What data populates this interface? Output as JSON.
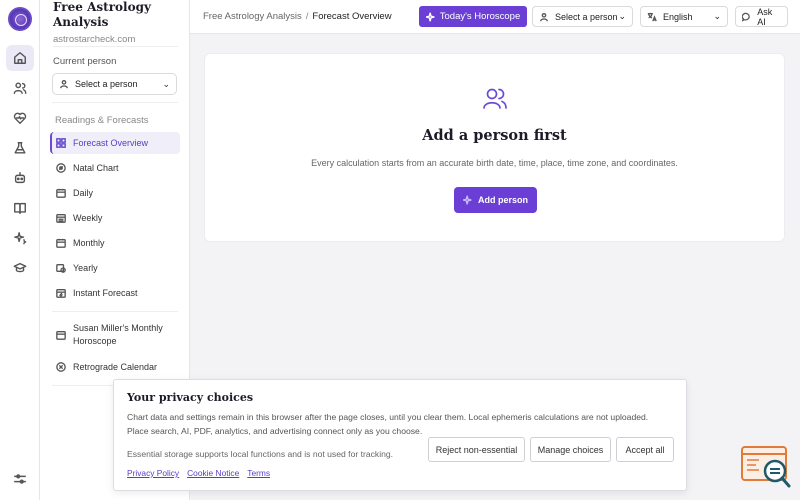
{
  "app": {
    "title": "Free Astrology Analysis",
    "domain": "astrostarcheck.com"
  },
  "sidebar": {
    "current_person_label": "Current person",
    "person_select": "Select a person",
    "section_label": "Readings & Forecasts",
    "items": [
      {
        "label": "Forecast Overview",
        "icon": "grid-icon"
      },
      {
        "label": "Natal Chart",
        "icon": "chart-wheel-icon"
      },
      {
        "label": "Daily",
        "icon": "calendar-icon"
      },
      {
        "label": "Weekly",
        "icon": "calendar-week-icon"
      },
      {
        "label": "Monthly",
        "icon": "calendar-month-icon"
      },
      {
        "label": "Yearly",
        "icon": "calendar-clock-icon"
      },
      {
        "label": "Instant Forecast",
        "icon": "calendar-bolt-icon"
      }
    ],
    "extra_items": [
      {
        "label": "Susan Miller's Monthly Horoscope",
        "icon": "calendar-icon"
      },
      {
        "label": "Retrograde Calendar",
        "icon": "retrograde-icon"
      }
    ]
  },
  "topbar": {
    "breadcrumb_root": "Free Astrology Analysis",
    "breadcrumb_sep": "/",
    "breadcrumb_current": "Forecast Overview",
    "horoscope_button": "Today's Horoscope",
    "person_select": "Select a person",
    "language_select": "English",
    "ask_ai_button": "Ask AI"
  },
  "main": {
    "heading": "Add a person first",
    "description": "Every calculation starts from an accurate birth date, time, place, time zone, and coordinates.",
    "add_button": "Add person"
  },
  "privacy": {
    "title": "Your privacy choices",
    "description": "Chart data and settings remain in this browser after the page closes, until you clear them. Local ephemeris calculations are not uploaded. Place search, AI, PDF, analytics, and advertising connect only as you choose.",
    "note": "Essential storage supports local functions and is not used for tracking.",
    "links": [
      "Privacy Policy",
      "Cookie Notice",
      "Terms"
    ],
    "reject_button": "Reject non-essential",
    "manage_button": "Manage choices",
    "accept_button": "Accept all"
  },
  "colors": {
    "accent": "#6b3fd6",
    "accent_text": "#5b3cc4"
  }
}
